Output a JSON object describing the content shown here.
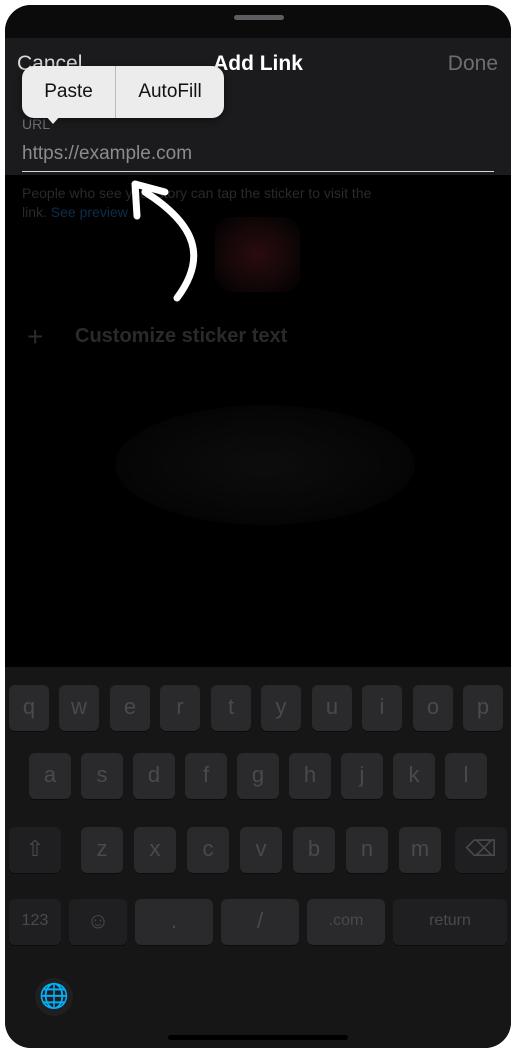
{
  "header": {
    "cancel_label": "Cancel",
    "title": "Add Link",
    "done_label": "Done"
  },
  "field": {
    "label": "URL",
    "placeholder": "https://example.com"
  },
  "edit_menu": {
    "paste_label": "Paste",
    "autofill_label": "AutoFill"
  },
  "background": {
    "helper_line1": "People who see your story can tap the sticker to visit the",
    "helper_line2": "link.",
    "helper_link": "See preview",
    "customize_label": "Customize sticker text"
  },
  "keyboard": {
    "row1": [
      "q",
      "w",
      "e",
      "r",
      "t",
      "y",
      "u",
      "i",
      "o",
      "p"
    ],
    "row2": [
      "a",
      "s",
      "d",
      "f",
      "g",
      "h",
      "j",
      "k",
      "l"
    ],
    "row3": [
      "z",
      "x",
      "c",
      "v",
      "b",
      "n",
      "m"
    ],
    "row4": {
      "numbers": "123",
      "emoji": "☺",
      "dot": ".",
      "slash": "/",
      "com": ".com",
      "return": "return"
    },
    "shift": "⇧",
    "backspace": "⌫",
    "globe": "🌐"
  },
  "colors": {
    "background": "#000000",
    "header": "#1b1b1d",
    "menu": "#ececec",
    "keyboard": "#161617",
    "arrow": "#ffffff"
  }
}
